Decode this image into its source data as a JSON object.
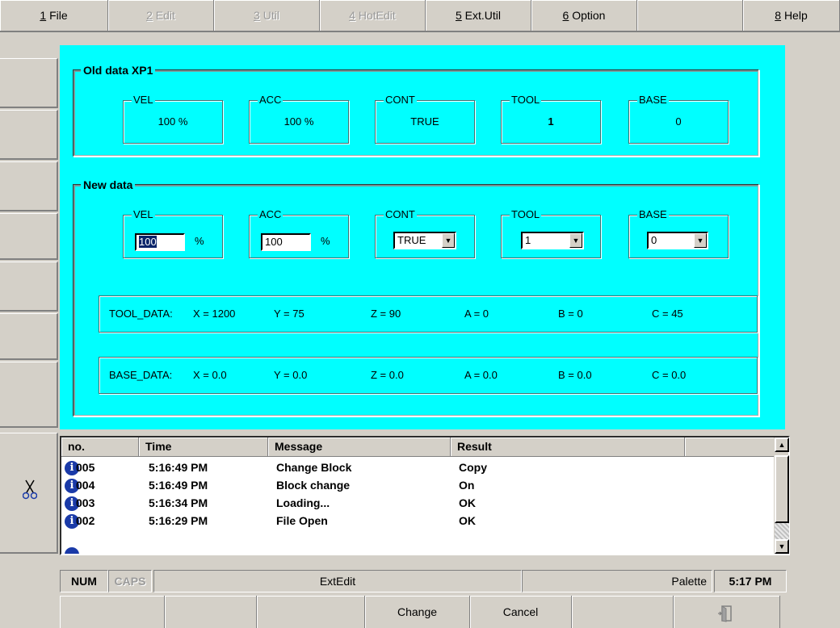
{
  "menu": {
    "items": [
      {
        "hotkey": "1",
        "label": "File",
        "enabled": true
      },
      {
        "hotkey": "2",
        "label": "Edit",
        "enabled": false
      },
      {
        "hotkey": "3",
        "label": "Util",
        "enabled": false
      },
      {
        "hotkey": "4",
        "label": "HotEdit",
        "enabled": false
      },
      {
        "hotkey": "5",
        "label": "Ext.Util",
        "enabled": true
      },
      {
        "hotkey": "6",
        "label": "Option",
        "enabled": true
      },
      {
        "hotkey": "",
        "label": "",
        "enabled": true
      },
      {
        "hotkey": "8",
        "label": "Help",
        "enabled": true
      }
    ]
  },
  "old_data": {
    "title": "Old data  XP1",
    "fields": [
      {
        "label": "VEL",
        "value": "100 %"
      },
      {
        "label": "ACC",
        "value": "100 %"
      },
      {
        "label": "CONT",
        "value": "TRUE"
      },
      {
        "label": "TOOL",
        "value": "1"
      },
      {
        "label": "BASE",
        "value": "0"
      }
    ]
  },
  "new_data": {
    "title": "New data",
    "vel": {
      "label": "VEL",
      "value": "100",
      "unit": "%"
    },
    "acc": {
      "label": "ACC",
      "value": "100",
      "unit": "%"
    },
    "cont": {
      "label": "CONT",
      "value": "TRUE"
    },
    "tool": {
      "label": "TOOL",
      "value": "1"
    },
    "base": {
      "label": "BASE",
      "value": "0"
    },
    "tool_data": {
      "label": "TOOL_DATA:",
      "x": "X = 1200",
      "y": "Y = 75",
      "z": "Z = 90",
      "a": "A = 0",
      "b": "B = 0",
      "c": "C = 45"
    },
    "base_data": {
      "label": "BASE_DATA:",
      "x": "X = 0.0",
      "y": "Y = 0.0",
      "z": "Z = 0.0",
      "a": "A = 0.0",
      "b": "B = 0.0",
      "c": "C = 0.0"
    }
  },
  "messages": {
    "headers": {
      "no": "no.",
      "time": "Time",
      "message": "Message",
      "result": "Result"
    },
    "rows": [
      {
        "no": "005",
        "time": "5:16:49 PM",
        "message": "Change Block",
        "result": "Copy"
      },
      {
        "no": "004",
        "time": "5:16:49 PM",
        "message": "Block change",
        "result": "On"
      },
      {
        "no": "003",
        "time": "5:16:34 PM",
        "message": "Loading...",
        "result": "OK"
      },
      {
        "no": "002",
        "time": "5:16:29 PM",
        "message": "File Open",
        "result": "OK"
      }
    ],
    "info_glyph": "i"
  },
  "status": {
    "num": "NUM",
    "caps": "CAPS",
    "mode": "ExtEdit",
    "palette": "Palette",
    "time": "5:17 PM"
  },
  "softkeys": {
    "change": "Change",
    "cancel": "Cancel"
  },
  "icons": {
    "side_tool": "scissors-icon",
    "exit": "exit-door-icon"
  },
  "colors": {
    "panel": "#00ffff",
    "info_icon": "#1a3aa8",
    "chrome": "#d4d0c8"
  }
}
